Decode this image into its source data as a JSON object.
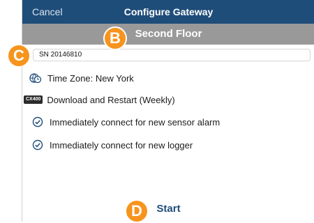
{
  "header": {
    "cancel_label": "Cancel",
    "title": "Configure Gateway",
    "bg_color": "#1f4d7a"
  },
  "subheader": {
    "title": "Second Floor",
    "bg_color": "#999999"
  },
  "serial_field": {
    "value": "SN 20146810"
  },
  "settings": {
    "time_zone": "Time Zone: New York",
    "download_badge": "CX400",
    "download": "Download and Restart (Weekly)",
    "sensor_alarm": "Immediately connect for new sensor alarm",
    "logger": "Immediately connect for new logger"
  },
  "footer": {
    "start_label": "Start"
  },
  "callouts": {
    "b": "B",
    "c": "C",
    "d": "D",
    "color": "#f7941d"
  }
}
